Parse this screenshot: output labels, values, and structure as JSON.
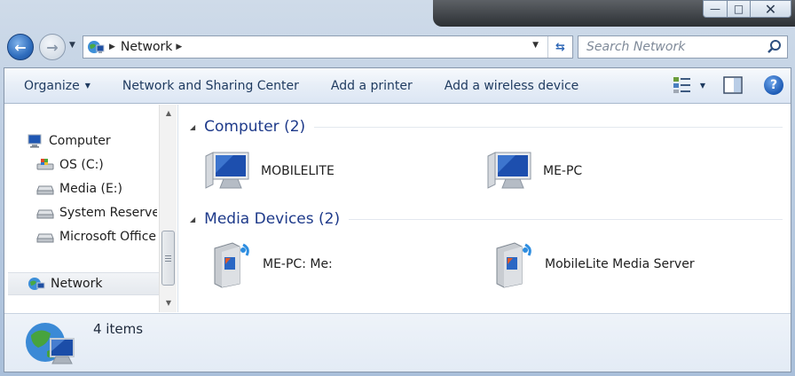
{
  "window": {
    "controls": {
      "minimize": "—",
      "maximize": "□",
      "close": "✕"
    }
  },
  "address": {
    "path": "Network",
    "search_placeholder": "Search Network"
  },
  "toolbar": {
    "organize": "Organize",
    "network_sharing": "Network and Sharing Center",
    "add_printer": "Add a printer",
    "add_wireless": "Add a wireless device"
  },
  "nav": {
    "items": [
      {
        "label": "Computer",
        "icon": "computer-icon"
      },
      {
        "label": "OS (C:)",
        "icon": "os-drive-icon"
      },
      {
        "label": "Media (E:)",
        "icon": "drive-icon"
      },
      {
        "label": "System Reserved",
        "icon": "drive-icon"
      },
      {
        "label": "Microsoft Office C",
        "icon": "drive-icon"
      },
      {
        "label": "Network",
        "icon": "network-icon",
        "selected": true
      }
    ]
  },
  "groups": [
    {
      "title": "Computer (2)",
      "items": [
        {
          "label": "MOBILELITE",
          "icon": "computer-icon"
        },
        {
          "label": "ME-PC",
          "icon": "computer-icon"
        }
      ]
    },
    {
      "title": "Media Devices (2)",
      "items": [
        {
          "label": "ME-PC: Me:",
          "icon": "media-server-icon"
        },
        {
          "label": "MobileLite Media Server",
          "icon": "media-server-icon"
        }
      ]
    }
  ],
  "details": {
    "count": "4 items"
  },
  "colors": {
    "accent": "#1e3a8a",
    "selection": "#e5e9ee",
    "toolbar": "#dce6f4"
  }
}
